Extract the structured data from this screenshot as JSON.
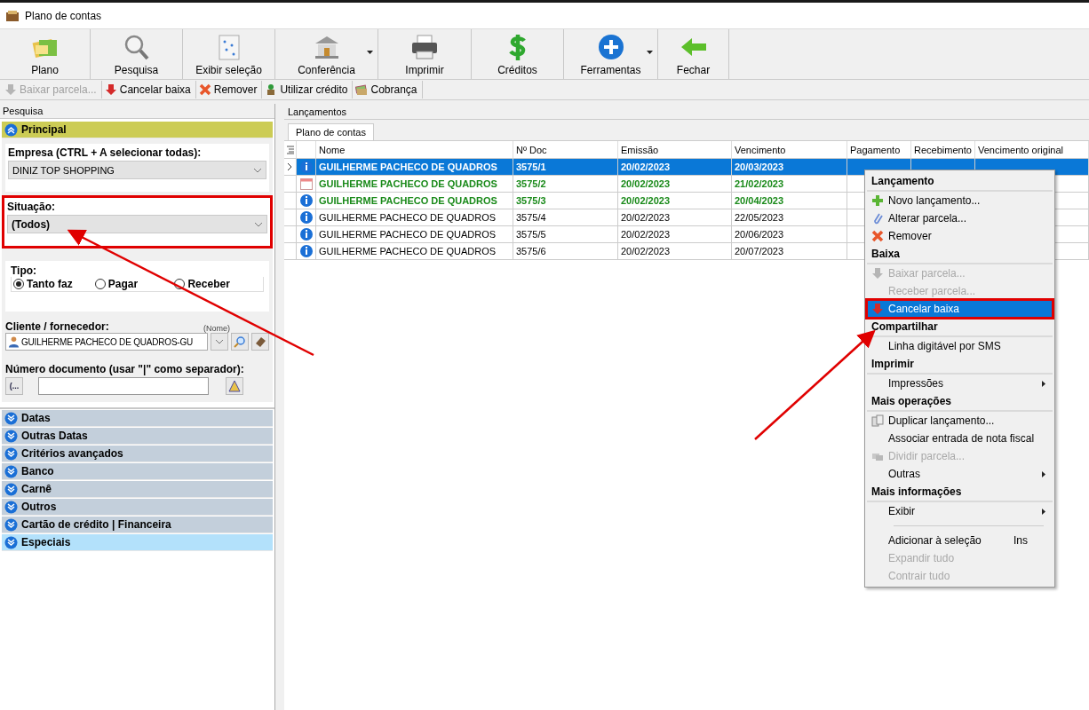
{
  "window": {
    "title": "Plano de contas"
  },
  "toolbar": [
    {
      "label": "Plano",
      "dropdown": false
    },
    {
      "label": "Pesquisa",
      "dropdown": false
    },
    {
      "label": "Exibir seleção",
      "dropdown": false
    },
    {
      "label": "Conferência",
      "dropdown": true
    },
    {
      "label": "Imprimir",
      "dropdown": false
    },
    {
      "label": "Créditos",
      "dropdown": false
    },
    {
      "label": "Ferramentas",
      "dropdown": true
    },
    {
      "label": "Fechar",
      "dropdown": false
    }
  ],
  "actions": [
    {
      "label": "Baixar parcela...",
      "disabled": true
    },
    {
      "label": "Cancelar baixa",
      "disabled": false
    },
    {
      "label": "Remover",
      "disabled": false
    },
    {
      "label": "Utilizar crédito",
      "disabled": false
    },
    {
      "label": "Cobrança",
      "disabled": false
    }
  ],
  "search_panel": {
    "title": "Pesquisa",
    "section": "Principal",
    "empresa": {
      "label": "Empresa (CTRL + A selecionar todas):",
      "value": "DINIZ TOP SHOPPING"
    },
    "situacao": {
      "label": "Situação:",
      "value": "(Todos)",
      "annotated": true
    },
    "tipo": {
      "label": "Tipo:",
      "options": [
        {
          "label": "Tanto faz",
          "selected": true
        },
        {
          "label": "Pagar",
          "selected": false
        },
        {
          "label": "Receber",
          "selected": false
        }
      ]
    },
    "cliente": {
      "label": "Cliente / fornecedor:",
      "hint": "(Nome)",
      "value": "GUILHERME PACHECO DE QUADROS-GU"
    },
    "numero": {
      "label": "Número documento (usar \"|\" como separador):",
      "button": "(..."
    },
    "groups": [
      {
        "label": "Datas",
        "selected": false
      },
      {
        "label": "Outras Datas",
        "selected": false
      },
      {
        "label": "Critérios avançados",
        "selected": false
      },
      {
        "label": "Banco",
        "selected": false
      },
      {
        "label": "Carnê",
        "selected": false
      },
      {
        "label": "Outros",
        "selected": false
      },
      {
        "label": "Cartão de crédito | Financeira",
        "selected": false
      },
      {
        "label": "Especiais",
        "selected": true
      }
    ]
  },
  "lancamentos": {
    "title": "Lançamentos",
    "tabs": [
      {
        "label": "Plano de contas",
        "selected": true
      }
    ],
    "columns": [
      "Nome",
      "Nº Doc",
      "Emissão",
      "Vencimento",
      "Pagamento",
      "Recebimento",
      "Vencimento original"
    ],
    "rows": [
      {
        "kind": "info",
        "selected": true,
        "emphasis": true,
        "cells": [
          "GUILHERME PACHECO DE QUADROS",
          "3575/1",
          "20/02/2023",
          "20/03/2023"
        ]
      },
      {
        "kind": "calendar",
        "selected": false,
        "emphasis": true,
        "cells": [
          "GUILHERME PACHECO DE QUADROS",
          "3575/2",
          "20/02/2023",
          "21/02/2023"
        ]
      },
      {
        "kind": "info",
        "selected": false,
        "emphasis": true,
        "cells": [
          "GUILHERME PACHECO DE QUADROS",
          "3575/3",
          "20/02/2023",
          "20/04/2023"
        ]
      },
      {
        "kind": "info",
        "selected": false,
        "emphasis": false,
        "cells": [
          "GUILHERME PACHECO DE QUADROS",
          "3575/4",
          "20/02/2023",
          "22/05/2023"
        ]
      },
      {
        "kind": "info",
        "selected": false,
        "emphasis": false,
        "cells": [
          "GUILHERME PACHECO DE QUADROS",
          "3575/5",
          "20/02/2023",
          "20/06/2023"
        ]
      },
      {
        "kind": "info",
        "selected": false,
        "emphasis": false,
        "cells": [
          "GUILHERME PACHECO DE QUADROS",
          "3575/6",
          "20/02/2023",
          "20/07/2023"
        ]
      }
    ]
  },
  "context_menu": [
    {
      "kind": "header",
      "label": "Lançamento"
    },
    {
      "kind": "item",
      "label": "Novo lançamento...",
      "disabled": false,
      "selected": false
    },
    {
      "kind": "item",
      "label": "Alterar parcela...",
      "disabled": false,
      "selected": false
    },
    {
      "kind": "item",
      "label": "Remover",
      "disabled": false,
      "selected": false
    },
    {
      "kind": "header",
      "label": "Baixa"
    },
    {
      "kind": "item",
      "label": "Baixar parcela...",
      "disabled": true,
      "selected": false
    },
    {
      "kind": "item",
      "label": "Receber parcela...",
      "disabled": true,
      "selected": false
    },
    {
      "kind": "item",
      "label": "Cancelar baixa",
      "disabled": false,
      "selected": true,
      "annotated": true
    },
    {
      "kind": "header",
      "label": "Compartilhar"
    },
    {
      "kind": "item",
      "label": "Linha digitável por SMS",
      "disabled": false,
      "selected": false
    },
    {
      "kind": "header",
      "label": "Imprimir"
    },
    {
      "kind": "item",
      "label": "Impressões",
      "submenu": true,
      "disabled": false,
      "selected": false
    },
    {
      "kind": "header",
      "label": "Mais operações"
    },
    {
      "kind": "item",
      "label": "Duplicar lançamento...",
      "disabled": false,
      "selected": false
    },
    {
      "kind": "item",
      "label": "Associar entrada de nota fiscal",
      "disabled": false,
      "selected": false
    },
    {
      "kind": "item",
      "label": "Dividir parcela...",
      "disabled": true,
      "selected": false
    },
    {
      "kind": "item",
      "label": "Outras",
      "submenu": true,
      "disabled": false,
      "selected": false
    },
    {
      "kind": "header",
      "label": "Mais informações"
    },
    {
      "kind": "item",
      "label": "Exibir",
      "submenu": true,
      "disabled": false,
      "selected": false
    },
    {
      "kind": "separator"
    },
    {
      "kind": "item",
      "label": "Adicionar à seleção",
      "shortcut": "Ins",
      "disabled": false,
      "selected": false
    },
    {
      "kind": "item",
      "label": "Expandir tudo",
      "disabled": true,
      "selected": false
    },
    {
      "kind": "item",
      "label": "Contrair tudo",
      "disabled": true,
      "selected": false
    }
  ]
}
